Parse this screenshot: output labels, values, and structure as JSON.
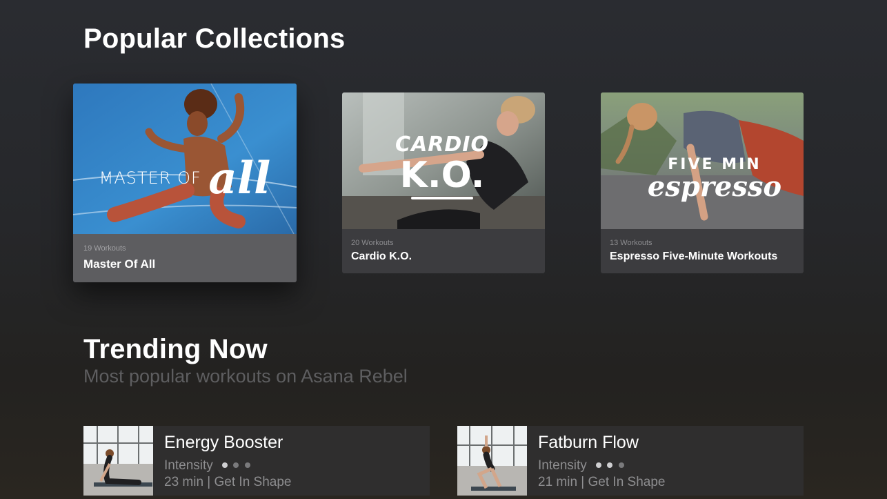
{
  "popular": {
    "title": "Popular Collections",
    "cards": [
      {
        "count": "19 Workouts",
        "title": "Master Of All",
        "overlay_top": "MASTER OF",
        "overlay_script": "all",
        "focused": true
      },
      {
        "count": "20 Workouts",
        "title": "Cardio K.O.",
        "overlay_top": "CARDIO",
        "overlay_script": "K.O.",
        "focused": false
      },
      {
        "count": "13 Workouts",
        "title": "Espresso Five-Minute Workouts",
        "overlay_top": "FIVE MIN",
        "overlay_script": "espresso",
        "focused": false
      }
    ]
  },
  "trending": {
    "title": "Trending Now",
    "subtitle": "Most popular workouts on Asana Rebel",
    "items": [
      {
        "name": "Energy Booster",
        "intensity_label": "Intensity",
        "intensity_level": 1,
        "intensity_max": 3,
        "meta": "23 min | Get In Shape"
      },
      {
        "name": "Fatburn Flow",
        "intensity_label": "Intensity",
        "intensity_level": 2,
        "intensity_max": 3,
        "meta": "21 min | Get In Shape"
      }
    ]
  },
  "colors": {
    "background": "#26272a",
    "card": "#3c3c3f",
    "card_focused": "#5d5d60",
    "muted_text": "#8e8e90",
    "subtitle_text": "#5e5e60"
  }
}
